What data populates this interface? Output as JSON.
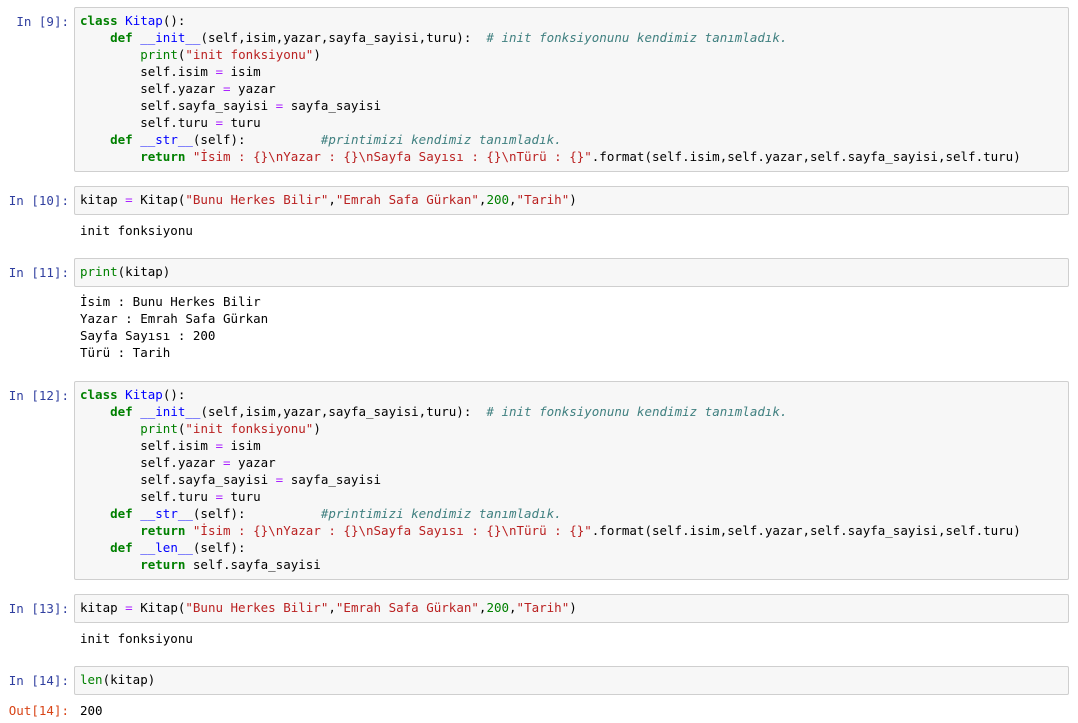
{
  "cells": [
    {
      "prompt": "In [9]:",
      "code": [
        [
          [
            "kw",
            "class"
          ],
          [
            "plain",
            " "
          ],
          [
            "cls",
            "Kitap"
          ],
          [
            "plain",
            "():"
          ]
        ],
        [
          [
            "plain",
            "    "
          ],
          [
            "kw",
            "def"
          ],
          [
            "plain",
            " "
          ],
          [
            "fn",
            "__init__"
          ],
          [
            "plain",
            "(self,isim,yazar,sayfa_sayisi,turu):  "
          ],
          [
            "cm",
            "# init fonksiyonunu kendimiz tanımladık."
          ]
        ],
        [
          [
            "plain",
            "        "
          ],
          [
            "bi",
            "print"
          ],
          [
            "plain",
            "("
          ],
          [
            "st",
            "\"init fonksiyonu\""
          ],
          [
            "plain",
            ")"
          ]
        ],
        [
          [
            "plain",
            "        self.isim "
          ],
          [
            "op",
            "="
          ],
          [
            "plain",
            " isim"
          ]
        ],
        [
          [
            "plain",
            "        self.yazar "
          ],
          [
            "op",
            "="
          ],
          [
            "plain",
            " yazar"
          ]
        ],
        [
          [
            "plain",
            "        self.sayfa_sayisi "
          ],
          [
            "op",
            "="
          ],
          [
            "plain",
            " sayfa_sayisi"
          ]
        ],
        [
          [
            "plain",
            "        self.turu "
          ],
          [
            "op",
            "="
          ],
          [
            "plain",
            " turu"
          ]
        ],
        [
          [
            "plain",
            "    "
          ],
          [
            "kw",
            "def"
          ],
          [
            "plain",
            " "
          ],
          [
            "fn",
            "__str__"
          ],
          [
            "plain",
            "(self):          "
          ],
          [
            "cm",
            "#printimizi kendimiz tanımladık."
          ]
        ],
        [
          [
            "plain",
            "        "
          ],
          [
            "kw",
            "return"
          ],
          [
            "plain",
            " "
          ],
          [
            "st",
            "\"İsim : {}\\nYazar : {}\\nSayfa Sayısı : {}\\nTürü : {}\""
          ],
          [
            "plain",
            ".format(self.isim,self.yazar,self.sayfa_sayisi,self.turu)"
          ]
        ]
      ],
      "output": []
    },
    {
      "prompt": "In [10]:",
      "code": [
        [
          [
            "plain",
            "kitap "
          ],
          [
            "op",
            "="
          ],
          [
            "plain",
            " Kitap("
          ],
          [
            "st",
            "\"Bunu Herkes Bilir\""
          ],
          [
            "plain",
            ","
          ],
          [
            "st",
            "\"Emrah Safa Gürkan\""
          ],
          [
            "plain",
            ","
          ],
          [
            "num",
            "200"
          ],
          [
            "plain",
            ","
          ],
          [
            "st",
            "\"Tarih\""
          ],
          [
            "plain",
            ")"
          ]
        ]
      ],
      "output": [
        "init fonksiyonu"
      ]
    },
    {
      "prompt": "In [11]:",
      "code": [
        [
          [
            "bi",
            "print"
          ],
          [
            "plain",
            "(kitap)"
          ]
        ]
      ],
      "output": [
        "İsim : Bunu Herkes Bilir",
        "Yazar : Emrah Safa Gürkan",
        "Sayfa Sayısı : 200",
        "Türü : Tarih"
      ]
    },
    {
      "prompt": "In [12]:",
      "code": [
        [
          [
            "kw",
            "class"
          ],
          [
            "plain",
            " "
          ],
          [
            "cls",
            "Kitap"
          ],
          [
            "plain",
            "():"
          ]
        ],
        [
          [
            "plain",
            "    "
          ],
          [
            "kw",
            "def"
          ],
          [
            "plain",
            " "
          ],
          [
            "fn",
            "__init__"
          ],
          [
            "plain",
            "(self,isim,yazar,sayfa_sayisi,turu):  "
          ],
          [
            "cm",
            "# init fonksiyonunu kendimiz tanımladık."
          ]
        ],
        [
          [
            "plain",
            "        "
          ],
          [
            "bi",
            "print"
          ],
          [
            "plain",
            "("
          ],
          [
            "st",
            "\"init fonksiyonu\""
          ],
          [
            "plain",
            ")"
          ]
        ],
        [
          [
            "plain",
            "        self.isim "
          ],
          [
            "op",
            "="
          ],
          [
            "plain",
            " isim"
          ]
        ],
        [
          [
            "plain",
            "        self.yazar "
          ],
          [
            "op",
            "="
          ],
          [
            "plain",
            " yazar"
          ]
        ],
        [
          [
            "plain",
            "        self.sayfa_sayisi "
          ],
          [
            "op",
            "="
          ],
          [
            "plain",
            " sayfa_sayisi"
          ]
        ],
        [
          [
            "plain",
            "        self.turu "
          ],
          [
            "op",
            "="
          ],
          [
            "plain",
            " turu"
          ]
        ],
        [
          [
            "plain",
            "    "
          ],
          [
            "kw",
            "def"
          ],
          [
            "plain",
            " "
          ],
          [
            "fn",
            "__str__"
          ],
          [
            "plain",
            "(self):          "
          ],
          [
            "cm",
            "#printimizi kendimiz tanımladık."
          ]
        ],
        [
          [
            "plain",
            "        "
          ],
          [
            "kw",
            "return"
          ],
          [
            "plain",
            " "
          ],
          [
            "st",
            "\"İsim : {}\\nYazar : {}\\nSayfa Sayısı : {}\\nTürü : {}\""
          ],
          [
            "plain",
            ".format(self.isim,self.yazar,self.sayfa_sayisi,self.turu)"
          ]
        ],
        [
          [
            "plain",
            "    "
          ],
          [
            "kw",
            "def"
          ],
          [
            "plain",
            " "
          ],
          [
            "fn",
            "__len__"
          ],
          [
            "plain",
            "(self):"
          ]
        ],
        [
          [
            "plain",
            "        "
          ],
          [
            "kw",
            "return"
          ],
          [
            "plain",
            " self.sayfa_sayisi"
          ]
        ]
      ],
      "output": []
    },
    {
      "prompt": "In [13]:",
      "code": [
        [
          [
            "plain",
            "kitap "
          ],
          [
            "op",
            "="
          ],
          [
            "plain",
            " Kitap("
          ],
          [
            "st",
            "\"Bunu Herkes Bilir\""
          ],
          [
            "plain",
            ","
          ],
          [
            "st",
            "\"Emrah Safa Gürkan\""
          ],
          [
            "plain",
            ","
          ],
          [
            "num",
            "200"
          ],
          [
            "plain",
            ","
          ],
          [
            "st",
            "\"Tarih\""
          ],
          [
            "plain",
            ")"
          ]
        ]
      ],
      "output": [
        "init fonksiyonu"
      ]
    },
    {
      "prompt": "In [14]:",
      "code": [
        [
          [
            "bi",
            "len"
          ],
          [
            "plain",
            "(kitap)"
          ]
        ]
      ],
      "output": [],
      "out_prompt": "Out[14]:",
      "out_value": "200"
    }
  ]
}
